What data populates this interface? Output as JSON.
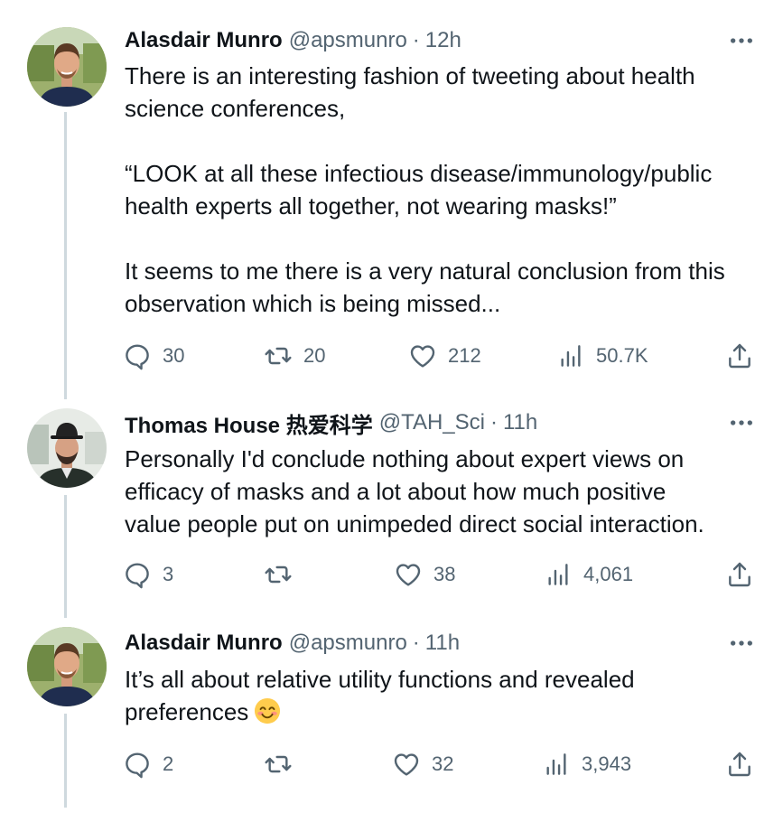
{
  "tweets": [
    {
      "author": "Alasdair Munro",
      "handle": "@apsmunro",
      "time": "12h",
      "text": "There is an interesting fashion of tweeting about health\nscience conferences,\n\n“LOOK at all these infectious disease/immunology/public\nhealth experts all together, not wearing masks!”\n\nIt seems to me there is a very natural conclusion from this\nobservation which is being missed...",
      "replies": "30",
      "retweets": "20",
      "likes": "212",
      "views": "50.7K"
    },
    {
      "author": "Thomas House 热爱科学",
      "handle": "@TAH_Sci",
      "time": "11h",
      "text": "Personally I'd conclude nothing about expert views on\nefficacy of masks and a lot about how much positive\nvalue people put on unimpeded direct social interaction.",
      "replies": "3",
      "retweets": "",
      "likes": "38",
      "views": "4,061"
    },
    {
      "author": "Alasdair Munro",
      "handle": "@apsmunro",
      "time": "11h",
      "text": "It’s all about relative utility functions and revealed\npreferences",
      "emoji": "smiling-face-icon",
      "replies": "2",
      "retweets": "",
      "likes": "32",
      "views": "3,943"
    }
  ],
  "icons": {
    "reply": "reply-icon",
    "retweet": "retweet-icon",
    "like": "like-icon",
    "views": "views-icon",
    "share": "share-icon",
    "more": "more-icon"
  },
  "colors": {
    "text": "#0f1419",
    "secondary": "#536471",
    "thread_line": "#cfd9de"
  }
}
